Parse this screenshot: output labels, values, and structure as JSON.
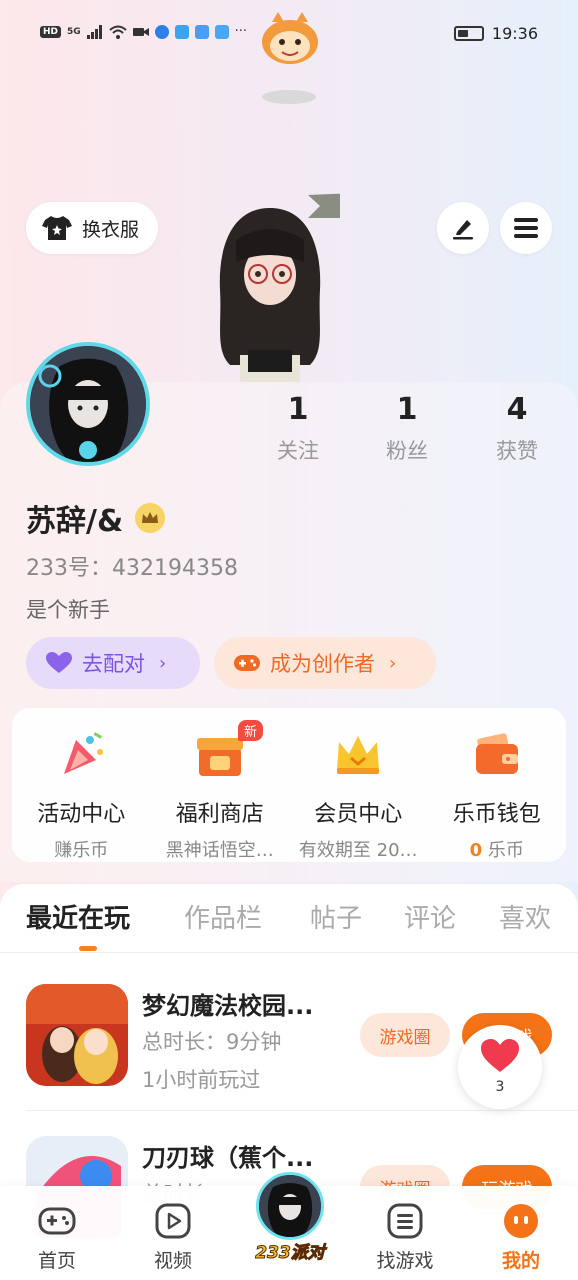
{
  "status_bar": {
    "network_label": "HD",
    "signal_label": "5G",
    "more": "···",
    "time": "19:36"
  },
  "header": {
    "outfit_label": "换衣服"
  },
  "profile": {
    "stats": [
      {
        "num": "1",
        "label": "关注"
      },
      {
        "num": "1",
        "label": "粉丝"
      },
      {
        "num": "4",
        "label": "获赞"
      }
    ],
    "username": "苏辞/&",
    "uid": "233号：432194358",
    "bio": "是个新手",
    "match_label": "去配对",
    "creator_label": "成为创作者"
  },
  "shortcuts": [
    {
      "title": "活动中心",
      "sub": "赚乐币"
    },
    {
      "title": "福利商店",
      "sub": "黑神话悟空…",
      "badge": "新"
    },
    {
      "title": "会员中心",
      "sub": "有效期至 20…"
    },
    {
      "title": "乐币钱包",
      "sub_num": "0",
      "sub": "乐币"
    }
  ],
  "tabs": [
    "最近在玩",
    "作品栏",
    "帖子",
    "评论",
    "喜欢"
  ],
  "games": [
    {
      "title": "梦幻魔法校园...",
      "duration": "总时长：9分钟",
      "last": "1小时前玩过",
      "circle_label": "游戏圈",
      "play_label": "玩游戏"
    },
    {
      "title": "刀刃球（蕉个...",
      "duration": "总时长",
      "circle_label": "游戏圈",
      "play_label": "玩游戏"
    }
  ],
  "heart_count": "3",
  "bottom_nav": {
    "home": "首页",
    "video": "视频",
    "party": "233派对",
    "find": "找游戏",
    "mine": "我的"
  },
  "colors": {
    "accent": "#f47316",
    "match": "#7b55e0",
    "creator": "#f06a24"
  }
}
